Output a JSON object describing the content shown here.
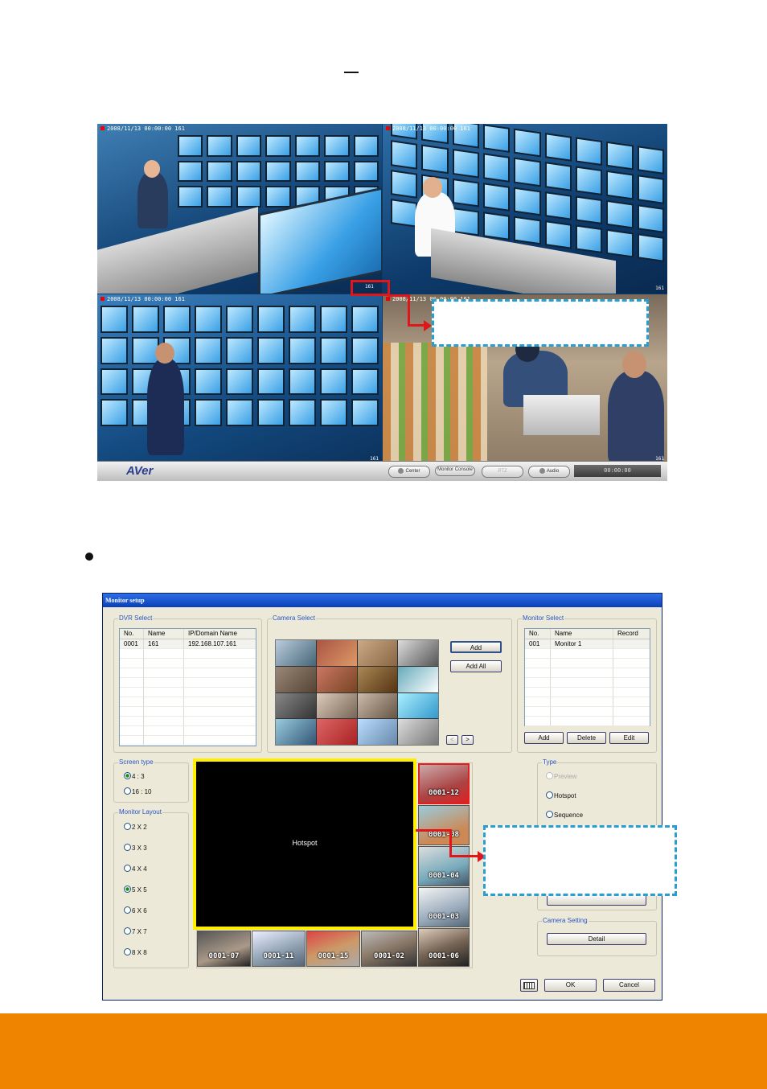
{
  "page": {
    "dash_glyph": "–",
    "footer_color": "#ee8400"
  },
  "viewer": {
    "cameras": [
      {
        "label": "2008/11/13 00:00:00 161",
        "tag": "161"
      },
      {
        "label": "2008/11/13 00:00:00 161",
        "tag": "161"
      },
      {
        "label": "2008/11/13 00:00:00 161",
        "tag": "161"
      },
      {
        "label": "2008/11/13 00:00:00 161",
        "tag": "161"
      }
    ],
    "logo": "AVer",
    "toolbar": {
      "center_label": "Center",
      "monitor_label": "Monitor Console",
      "disabled_label": "PTZ",
      "audio_label": "Audio",
      "clock": "00:00:00"
    },
    "highlight_label": "161",
    "accent_red": "#e0161b",
    "callout_border": "#2a9ed0"
  },
  "dialog": {
    "title": "Monitor setup",
    "dvr_select": {
      "title": "DVR Select",
      "columns": [
        "No.",
        "Name",
        "IP/Domain Name"
      ],
      "rows": [
        [
          "0001",
          "161",
          "192.168.107.161"
        ]
      ]
    },
    "camera_select": {
      "title": "Camera Select",
      "add_label": "Add",
      "add_all_label": "Add All",
      "prev_label": "<",
      "next_label": ">"
    },
    "monitor_select": {
      "title": "Monitor Select",
      "columns": [
        "No.",
        "Name",
        "Record"
      ],
      "rows": [
        [
          "001",
          "Monitor 1",
          ""
        ]
      ],
      "add_label": "Add",
      "delete_label": "Delete",
      "edit_label": "Edit"
    },
    "screen_type": {
      "title": "Screen type",
      "options": [
        "4 : 3",
        "16 : 10"
      ],
      "selected": "4 : 3"
    },
    "monitor_layout": {
      "title": "Monitor Layout",
      "options": [
        "2 X 2",
        "3 X 3",
        "4 X 4",
        "5 X 5",
        "6 X 6",
        "7 X 7",
        "8 X 8"
      ],
      "selected": "5 X 5"
    },
    "hotspot_label": "Hotspot",
    "strip_right": [
      "0001-12",
      "0001-08",
      "0001-04",
      "0001-03",
      "0001-06"
    ],
    "strip_bottom": [
      "0001-07",
      "0001-11",
      "0001-15",
      "0001-02"
    ],
    "type": {
      "title": "Type",
      "options": [
        "Preview",
        "Hotspot",
        "Sequence"
      ]
    },
    "camera_setting": {
      "title": "Camera Setting",
      "detail_label": "Detail"
    },
    "ok_label": "OK",
    "cancel_label": "Cancel",
    "hotspot_border": "#ffee00"
  }
}
